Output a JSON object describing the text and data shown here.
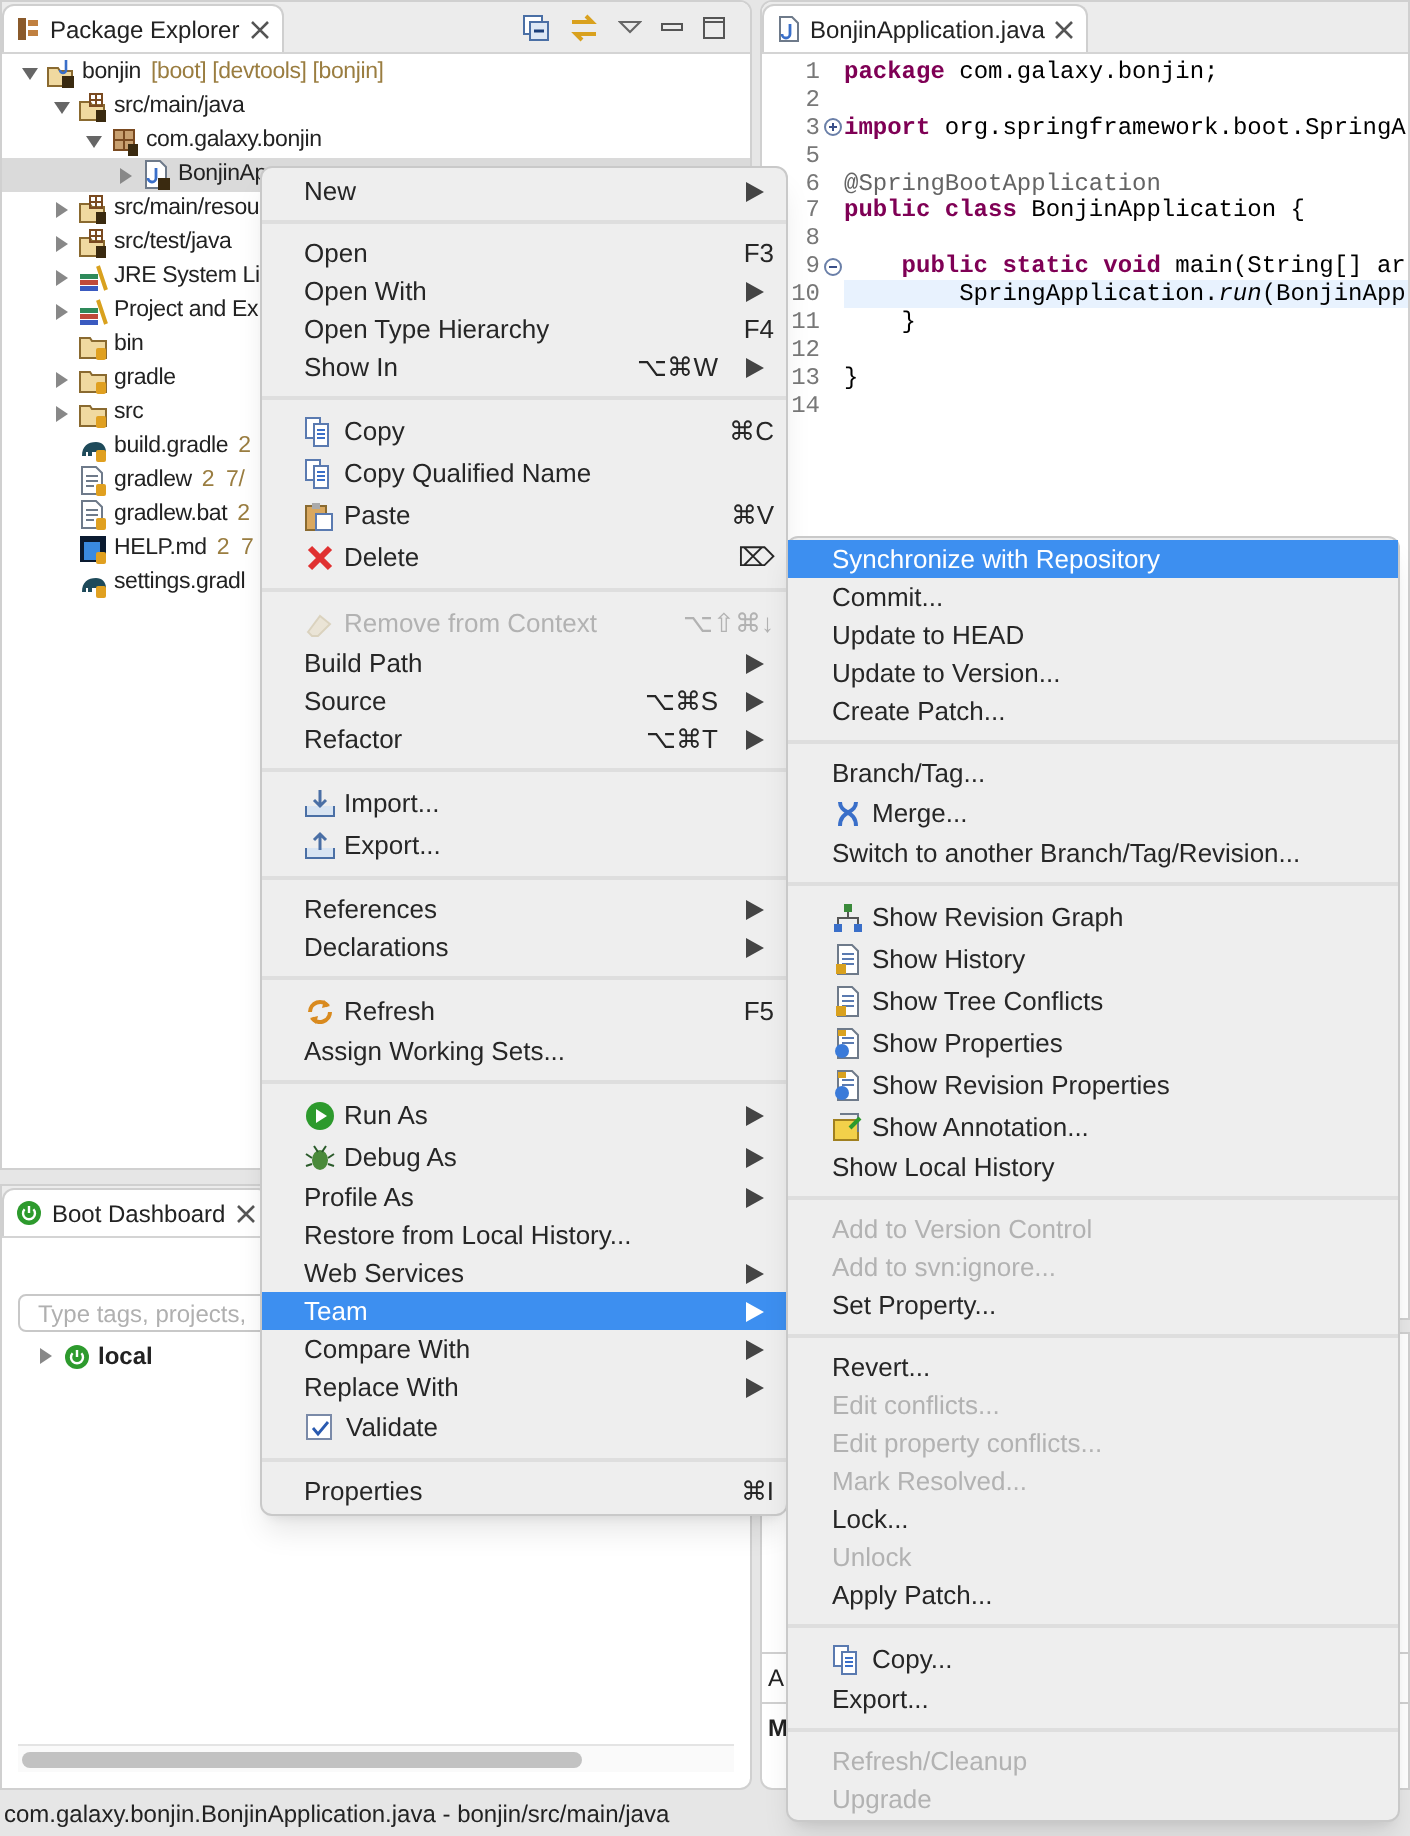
{
  "package_explorer": {
    "title": "Package Explorer",
    "tree": [
      {
        "label": "bonjin",
        "decoration": "[boot] [devtools] [bonjin]",
        "kind": "project",
        "expanded": true,
        "selected": false,
        "children": [
          {
            "label": "src/main/java",
            "kind": "source-folder",
            "expanded": true,
            "selected": false,
            "children": [
              {
                "label": "com.galaxy.bonjin",
                "kind": "package",
                "expanded": true,
                "selected": false,
                "children": [
                  {
                    "label": "BonjinAp",
                    "kind": "java-file",
                    "expanded": false,
                    "selected": true
                  }
                ]
              }
            ]
          },
          {
            "label": "src/main/resou",
            "kind": "source-folder",
            "expanded": false,
            "selected": false
          },
          {
            "label": "src/test/java",
            "kind": "source-folder",
            "expanded": false,
            "selected": false
          },
          {
            "label": "JRE System Li",
            "kind": "library",
            "expanded": false,
            "selected": false
          },
          {
            "label": "Project and Ex",
            "kind": "library",
            "expanded": false,
            "selected": false
          },
          {
            "label": "bin",
            "kind": "folder",
            "selected": false
          },
          {
            "label": "gradle",
            "kind": "folder",
            "expanded": false,
            "selected": false
          },
          {
            "label": "src",
            "kind": "folder",
            "expanded": false,
            "selected": false
          },
          {
            "label": "build.gradle",
            "decoration": "2",
            "kind": "elephant",
            "selected": false
          },
          {
            "label": "gradlew",
            "decoration": "2  7/",
            "kind": "text-file",
            "selected": false
          },
          {
            "label": "gradlew.bat",
            "decoration": "2",
            "kind": "text-file",
            "selected": false
          },
          {
            "label": "HELP.md",
            "decoration": "2  7",
            "kind": "image-file",
            "selected": false
          },
          {
            "label": "settings.gradl",
            "kind": "elephant",
            "selected": false
          }
        ]
      }
    ]
  },
  "editor": {
    "tab": "BonjinApplication.java",
    "lines": [
      {
        "number": "1",
        "parts": [
          {
            "text": "package",
            "kind": "keyword"
          },
          {
            "text": " com.galaxy.bonjin;",
            "kind": "plain"
          }
        ]
      },
      {
        "number": "2"
      },
      {
        "number": "3",
        "kind": "expandable",
        "parts": [
          {
            "text": "import",
            "kind": "keyword"
          },
          {
            "text": " org.springframework.boot.SpringA",
            "kind": "plain"
          }
        ]
      },
      {
        "number": "5"
      },
      {
        "number": "6",
        "parts": [
          {
            "text": "@SpringBootApplication",
            "kind": "annotation"
          }
        ]
      },
      {
        "number": "7",
        "parts": [
          {
            "text": "public class",
            "kind": "keyword"
          },
          {
            "text": " BonjinApplication {",
            "kind": "plain"
          }
        ]
      },
      {
        "number": "8"
      },
      {
        "number": "9",
        "kind": "collapsible",
        "parts": [
          {
            "text": "    public static void",
            "kind": "keyword"
          },
          {
            "text": " main(String[] ar",
            "kind": "plain"
          }
        ]
      },
      {
        "number": "10",
        "current": true,
        "parts": [
          {
            "text": "        SpringApplication.",
            "kind": "plain"
          },
          {
            "text": "run",
            "kind": "italic"
          },
          {
            "text": "(BonjinApp",
            "kind": "plain"
          }
        ]
      },
      {
        "number": "11",
        "parts": [
          {
            "text": "    }",
            "kind": "plain"
          }
        ]
      },
      {
        "number": "12"
      },
      {
        "number": "13",
        "parts": [
          {
            "text": "}",
            "kind": "plain"
          }
        ]
      },
      {
        "number": "14"
      }
    ]
  },
  "boot_dashboard": {
    "title": "Boot Dashboard",
    "search": {
      "placeholder": "Type tags, projects,"
    },
    "tree": [
      {
        "label": "local",
        "expanded": false
      }
    ]
  },
  "lower_panel": {
    "header": "A",
    "row": "M"
  },
  "status_bar": "com.galaxy.bonjin.BonjinApplication.java - bonjin/src/main/java",
  "context_menu": {
    "groups": [
      {
        "items": [
          {
            "label": "New",
            "arrow": true,
            "selected": false,
            "disabled": false
          }
        ]
      },
      {
        "items": [
          {
            "label": "Open",
            "shortcut": "F3",
            "selected": false,
            "disabled": false
          },
          {
            "label": "Open With",
            "arrow": true,
            "selected": false,
            "disabled": false
          },
          {
            "label": "Open Type Hierarchy",
            "shortcut": "F4",
            "selected": false,
            "disabled": false
          },
          {
            "label": "Show In",
            "shortcut": "⌥⌘W",
            "arrow": true,
            "selected": false,
            "disabled": false
          }
        ]
      },
      {
        "items": [
          {
            "label": "Copy",
            "shortcut": "⌘C",
            "kind": "pages",
            "selected": false,
            "disabled": false
          },
          {
            "label": "Copy Qualified Name",
            "kind": "pages",
            "selected": false,
            "disabled": false
          },
          {
            "label": "Paste",
            "shortcut": "⌘V",
            "kind": "clipboard",
            "selected": false,
            "disabled": false
          },
          {
            "label": "Delete",
            "shortcut": "⌦",
            "kind": "cross",
            "selected": false,
            "disabled": false
          }
        ]
      },
      {
        "items": [
          {
            "label": "Remove from Context",
            "shortcut": "⌥⇧⌘↓",
            "kind": "eraser",
            "selected": false,
            "disabled": true
          },
          {
            "label": "Build Path",
            "arrow": true,
            "selected": false,
            "disabled": false
          },
          {
            "label": "Source",
            "shortcut": "⌥⌘S",
            "arrow": true,
            "selected": false,
            "disabled": false
          },
          {
            "label": "Refactor",
            "shortcut": "⌥⌘T",
            "arrow": true,
            "selected": false,
            "disabled": false
          }
        ]
      },
      {
        "items": [
          {
            "label": "Import...",
            "kind": "tray-in",
            "selected": false,
            "disabled": false
          },
          {
            "label": "Export...",
            "kind": "tray-out",
            "selected": false,
            "disabled": false
          }
        ]
      },
      {
        "items": [
          {
            "label": "References",
            "arrow": true,
            "selected": false,
            "disabled": false
          },
          {
            "label": "Declarations",
            "arrow": true,
            "selected": false,
            "disabled": false
          }
        ]
      },
      {
        "items": [
          {
            "label": "Refresh",
            "shortcut": "F5",
            "kind": "refresh",
            "selected": false,
            "disabled": false
          },
          {
            "label": "Assign Working Sets...",
            "selected": false,
            "disabled": false
          }
        ]
      },
      {
        "items": [
          {
            "label": "Run As",
            "kind": "play",
            "arrow": true,
            "selected": false,
            "disabled": false
          },
          {
            "label": "Debug As",
            "kind": "bug",
            "arrow": true,
            "selected": false,
            "disabled": false
          },
          {
            "label": "Profile As",
            "arrow": true,
            "selected": false,
            "disabled": false
          },
          {
            "label": "Restore from Local History...",
            "selected": false,
            "disabled": false
          },
          {
            "label": "Web Services",
            "arrow": true,
            "selected": false,
            "disabled": false
          },
          {
            "label": "Team",
            "arrow": true,
            "selected": true,
            "disabled": false
          },
          {
            "label": "Compare With",
            "arrow": true,
            "selected": false,
            "disabled": false
          },
          {
            "label": "Replace With",
            "arrow": true,
            "selected": false,
            "disabled": false
          },
          {
            "label": "Validate",
            "kind": "checkbox",
            "checked": true,
            "selected": false,
            "disabled": false
          }
        ]
      },
      {
        "items": [
          {
            "label": "Properties",
            "shortcut": "⌘I",
            "selected": false,
            "disabled": false
          }
        ]
      }
    ]
  },
  "team_submenu": {
    "groups": [
      {
        "items": [
          {
            "label": "Synchronize with Repository",
            "selected": true,
            "disabled": false
          },
          {
            "label": "Commit...",
            "selected": false,
            "disabled": false
          },
          {
            "label": "Update to HEAD",
            "selected": false,
            "disabled": false
          },
          {
            "label": "Update to Version...",
            "selected": false,
            "disabled": false
          },
          {
            "label": "Create Patch...",
            "selected": false,
            "disabled": false
          }
        ]
      },
      {
        "items": [
          {
            "label": "Branch/Tag...",
            "selected": false,
            "disabled": false
          },
          {
            "label": "Merge...",
            "kind": "fork",
            "selected": false,
            "disabled": false
          },
          {
            "label": "Switch to another Branch/Tag/Revision...",
            "selected": false,
            "disabled": false
          }
        ]
      },
      {
        "items": [
          {
            "label": "Show Revision Graph",
            "kind": "hierarchy",
            "selected": false,
            "disabled": false
          },
          {
            "label": "Show History",
            "kind": "page",
            "selected": false,
            "disabled": false
          },
          {
            "label": "Show Tree Conflicts",
            "kind": "page",
            "selected": false,
            "disabled": false
          },
          {
            "label": "Show Properties",
            "kind": "page-badge",
            "selected": false,
            "disabled": false
          },
          {
            "label": "Show Revision Properties",
            "kind": "page-badge",
            "selected": false,
            "disabled": false
          },
          {
            "label": "Show Annotation...",
            "kind": "folder-note",
            "selected": false,
            "disabled": false
          },
          {
            "label": "Show Local History",
            "selected": false,
            "disabled": false
          }
        ]
      },
      {
        "items": [
          {
            "label": "Add to Version Control",
            "selected": false,
            "disabled": true
          },
          {
            "label": "Add to svn:ignore...",
            "selected": false,
            "disabled": true
          },
          {
            "label": "Set Property...",
            "selected": false,
            "disabled": false
          }
        ]
      },
      {
        "items": [
          {
            "label": "Revert...",
            "selected": false,
            "disabled": false
          },
          {
            "label": "Edit conflicts...",
            "selected": false,
            "disabled": true
          },
          {
            "label": "Edit property conflicts...",
            "selected": false,
            "disabled": true
          },
          {
            "label": "Mark Resolved...",
            "selected": false,
            "disabled": true
          },
          {
            "label": "Lock...",
            "selected": false,
            "disabled": false
          },
          {
            "label": "Unlock",
            "selected": false,
            "disabled": true
          },
          {
            "label": "Apply Patch...",
            "selected": false,
            "disabled": false
          }
        ]
      },
      {
        "items": [
          {
            "label": "Copy...",
            "kind": "pages",
            "selected": false,
            "disabled": false
          },
          {
            "label": "Export...",
            "selected": false,
            "disabled": false
          }
        ]
      },
      {
        "items": [
          {
            "label": "Refresh/Cleanup",
            "selected": false,
            "disabled": true
          },
          {
            "label": "Upgrade",
            "selected": false,
            "disabled": true
          }
        ]
      }
    ]
  }
}
